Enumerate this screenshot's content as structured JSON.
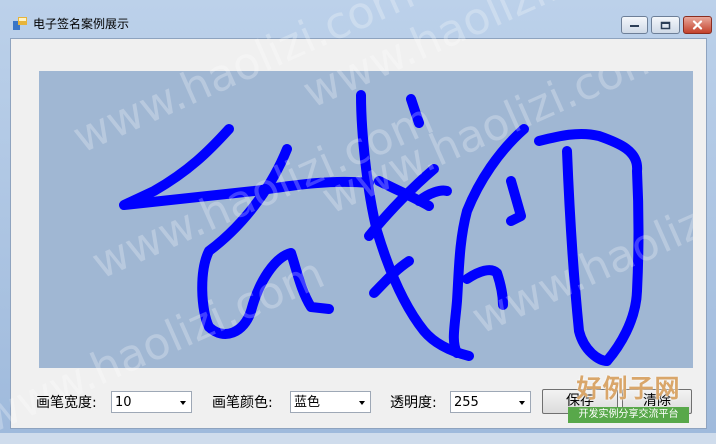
{
  "window": {
    "title": "电子签名案例展示",
    "controls": {
      "minimize_icon": "minimize-icon",
      "maximize_icon": "maximize-icon",
      "close_icon": "close-icon"
    }
  },
  "signature_pad": {
    "background": "#a0b7d3",
    "stroke_color": "#0000ff",
    "stroke_width": 10
  },
  "toolbar": {
    "pen_width_label": "画笔宽度:",
    "pen_width_value": "10",
    "pen_color_label": "画笔颜色:",
    "pen_color_value": "蓝色",
    "opacity_label": "透明度:",
    "opacity_value": "255",
    "save_label": "保存",
    "clear_label": "清除"
  },
  "watermark": {
    "text": "www.haolizi.com",
    "logo_main": "好例子网",
    "logo_sub": "开发实例分享交流平台"
  }
}
